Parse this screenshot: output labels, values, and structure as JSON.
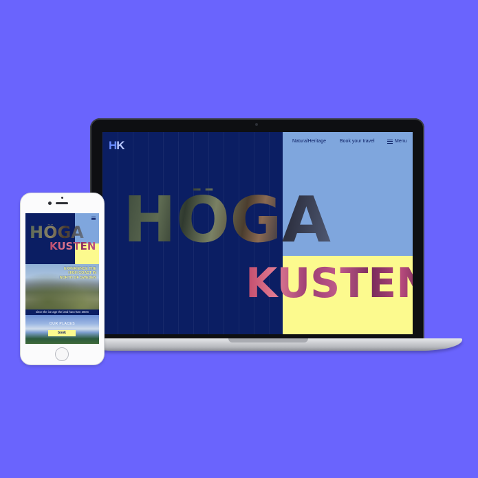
{
  "colors": {
    "background": "#6a64fd",
    "navy": "#0b1e63",
    "sky_blue": "#7fa6dd",
    "pale_yellow": "#fcfa8e",
    "logo_blue": "#6a8cff"
  },
  "laptop": {
    "logo": {
      "h": "H",
      "k": "K"
    },
    "nav": {
      "natural_heritage": "NaturalHeritage",
      "book_travel": "Book your travel",
      "menu": "Menu",
      "menu_icon": "hamburger-icon"
    },
    "hero": {
      "title_line1": "HÖGA",
      "title_line2": "KUSTEN"
    }
  },
  "phone": {
    "menu_icon": "hamburger-icon",
    "hero": {
      "title_line1": "HÖGA",
      "title_line2": "KUSTEN"
    },
    "experience_text": "EXPERIENCE THE HIGH COAST IN NORTH OF SWEDEN",
    "strip_text": "since the ice age the land has risen 300m",
    "water_label": "OUR PLACES",
    "book_label": "book"
  }
}
